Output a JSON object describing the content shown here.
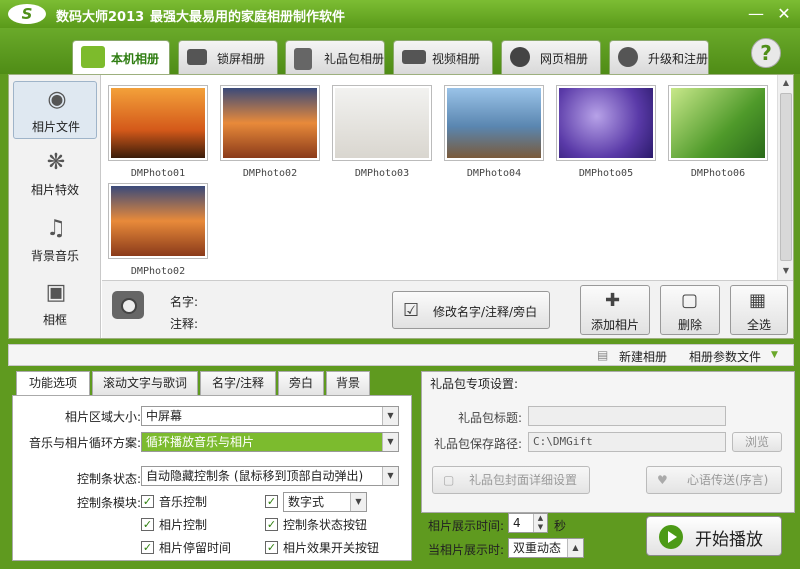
{
  "window": {
    "logo": "S",
    "title": "数码大师2013",
    "slogan": "最强大最易用的家庭相册制作软件",
    "minimize": "—",
    "close": "✕"
  },
  "top_tabs": [
    {
      "label": "本机相册",
      "icon": "user-photo-icon",
      "color": "#7dbb2c",
      "active": true
    },
    {
      "label": "锁屏相册",
      "icon": "monitor-icon",
      "color": "#555555"
    },
    {
      "label": "礼品包相册",
      "icon": "gift-icon",
      "color": "#555555"
    },
    {
      "label": "视频相册",
      "icon": "film-icon",
      "color": "#555555"
    },
    {
      "label": "网页相册",
      "icon": "ie-icon",
      "color": "#444444"
    },
    {
      "label": "升级和注册",
      "icon": "globe-icon",
      "color": "#555555"
    }
  ],
  "help": "?",
  "left_nav": [
    {
      "label": "相片文件",
      "icon": "camera-icon",
      "active": true
    },
    {
      "label": "相片特效",
      "icon": "sparkle-icon"
    },
    {
      "label": "背景音乐",
      "icon": "music-note-icon"
    },
    {
      "label": "相框",
      "icon": "picture-frame-icon"
    }
  ],
  "photos": [
    {
      "name": "DMPhoto01"
    },
    {
      "name": "DMPhoto02"
    },
    {
      "name": "DMPhoto03"
    },
    {
      "name": "DMPhoto04"
    },
    {
      "name": "DMPhoto05"
    },
    {
      "name": "DMPhoto06"
    },
    {
      "name": "DMPhoto02"
    }
  ],
  "info": {
    "name_label": "名字:",
    "note_label": "注释:",
    "edit_button": "修改名字/注释/旁白",
    "add_button": "添加相片",
    "delete_button": "删除",
    "select_all_button": "全选"
  },
  "strip": {
    "new_album": "新建相册",
    "album_params": "相册参数文件"
  },
  "bottom_tabs": [
    "功能选项",
    "滚动文字与歌词",
    "名字/注释",
    "旁白",
    "背景"
  ],
  "options": {
    "photo_area_label": "相片区域大小:",
    "photo_area_value": "中屏幕",
    "loop_label": "音乐与相片循环方案:",
    "loop_value": "循环播放音乐与相片",
    "control_state_label": "控制条状态:",
    "control_state_value": "自动隐藏控制条 (鼠标移到顶部自动弹出)",
    "control_module_label": "控制条模块:",
    "checks": [
      {
        "label": "音乐控制",
        "checked": true
      },
      {
        "label": "相片控制",
        "checked": true
      },
      {
        "label": "相片停留时间",
        "checked": true
      },
      {
        "label": "数字式",
        "checked": true
      },
      {
        "label": "控制条状态按钮",
        "checked": true
      },
      {
        "label": "相片效果开关按钮",
        "checked": true
      }
    ]
  },
  "gift": {
    "header": "礼品包专项设置:",
    "title_label": "礼品包标题:",
    "title_value": "",
    "path_label": "礼品包保存路径:",
    "path_value": "C:\\DMGift",
    "browse": "浏览",
    "cover_button": "礼品包封面详细设置",
    "message_button": "心语传送(序言)"
  },
  "playback": {
    "duration_label": "相片展示时间:",
    "duration_value": "4",
    "duration_unit": "秒",
    "when_label": "当相片展示时:",
    "when_value": "双重动态",
    "play_button": "开始播放"
  }
}
